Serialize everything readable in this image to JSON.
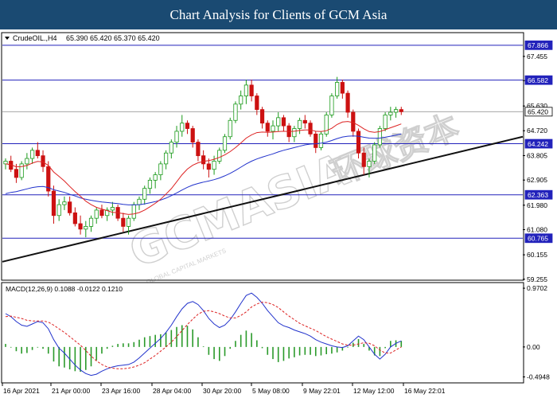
{
  "header": {
    "title": "Chart Analysis for Clients of GCM Asia"
  },
  "watermark": {
    "brand": "GCMASIA",
    "chinese": "环球资本",
    "sub": "GLOBAL CAPITAL MARKETS"
  },
  "colors": {
    "header_bg": "#1a4a72",
    "bull": "#1a9a1a",
    "bear": "#cc1111",
    "ma_fast": "#dd2222",
    "ma_slow": "#2233cc",
    "level_line": "#2222bb",
    "trend_line": "#111111",
    "macd_line": "#2233cc",
    "signal_line": "#dd2222",
    "hist": "#2a9a2a"
  },
  "chart_data": [
    {
      "type": "candlestick",
      "symbol_label": "CrudeOIL.,H4",
      "ohlc_label": "65.390 65.420 65.370 65.420",
      "ylim": [
        59.25,
        68.3
      ],
      "y_ticks": [
        "67.455",
        "66.565",
        "65.630",
        "64.720",
        "63.805",
        "62.905",
        "61.980",
        "61.080",
        "60.155",
        "59.255"
      ],
      "x_ticks": [
        "16 Apr 2021",
        "21 Apr 00:00",
        "23 Apr 16:00",
        "28 Apr 04:00",
        "30 Apr 20:00",
        "5 May 08:00",
        "9 May 22:01",
        "12 May 12:00",
        "16 May 22:01"
      ],
      "levels": [
        67.866,
        66.582,
        65.42,
        64.242,
        62.363,
        60.765
      ],
      "current_price": 65.42,
      "candles": [
        [
          63.5,
          63.7,
          63.3,
          63.6
        ],
        [
          63.6,
          63.8,
          63.2,
          63.3
        ],
        [
          63.3,
          63.5,
          62.8,
          63.0
        ],
        [
          63.0,
          63.6,
          62.9,
          63.5
        ],
        [
          63.5,
          63.9,
          63.3,
          63.7
        ],
        [
          63.7,
          64.1,
          63.5,
          64.0
        ],
        [
          64.0,
          64.3,
          63.7,
          63.8
        ],
        [
          63.8,
          64.0,
          63.2,
          63.4
        ],
        [
          63.4,
          63.6,
          62.3,
          62.5
        ],
        [
          62.5,
          62.7,
          61.3,
          61.6
        ],
        [
          61.6,
          62.2,
          61.4,
          62.0
        ],
        [
          62.0,
          62.3,
          61.8,
          62.1
        ],
        [
          62.1,
          62.3,
          61.6,
          61.7
        ],
        [
          61.7,
          61.9,
          61.2,
          61.3
        ],
        [
          61.3,
          61.6,
          60.9,
          61.1
        ],
        [
          61.1,
          61.4,
          60.8,
          61.2
        ],
        [
          61.2,
          61.6,
          61.0,
          61.5
        ],
        [
          61.5,
          61.9,
          61.3,
          61.8
        ],
        [
          61.8,
          62.0,
          61.5,
          61.6
        ],
        [
          61.6,
          61.9,
          61.4,
          61.8
        ],
        [
          61.8,
          62.1,
          61.6,
          61.9
        ],
        [
          61.9,
          62.0,
          61.4,
          61.5
        ],
        [
          61.5,
          61.7,
          61.0,
          61.2
        ],
        [
          61.2,
          61.6,
          60.9,
          61.5
        ],
        [
          61.5,
          62.1,
          61.4,
          62.0
        ],
        [
          62.0,
          62.3,
          61.8,
          62.2
        ],
        [
          62.2,
          62.7,
          62.0,
          62.6
        ],
        [
          62.6,
          63.0,
          62.4,
          62.9
        ],
        [
          62.9,
          63.2,
          62.6,
          63.1
        ],
        [
          63.1,
          63.6,
          62.9,
          63.5
        ],
        [
          63.5,
          64.0,
          63.3,
          63.9
        ],
        [
          63.9,
          64.4,
          63.7,
          64.3
        ],
        [
          64.3,
          64.9,
          64.1,
          64.7
        ],
        [
          64.7,
          65.3,
          64.5,
          65.0
        ],
        [
          65.0,
          65.1,
          64.6,
          64.8
        ],
        [
          64.8,
          64.9,
          64.1,
          64.3
        ],
        [
          64.3,
          64.4,
          63.6,
          63.8
        ],
        [
          63.8,
          64.0,
          63.3,
          63.5
        ],
        [
          63.5,
          63.7,
          63.0,
          63.3
        ],
        [
          63.3,
          63.8,
          63.1,
          63.6
        ],
        [
          63.6,
          64.1,
          63.5,
          64.0
        ],
        [
          64.0,
          64.6,
          63.9,
          64.5
        ],
        [
          64.5,
          65.2,
          64.4,
          65.1
        ],
        [
          65.1,
          65.8,
          65.0,
          65.7
        ],
        [
          65.7,
          66.2,
          65.5,
          66.0
        ],
        [
          66.0,
          66.6,
          65.7,
          66.4
        ],
        [
          66.4,
          66.6,
          65.8,
          66.0
        ],
        [
          66.0,
          66.1,
          65.3,
          65.5
        ],
        [
          65.5,
          65.6,
          64.8,
          65.0
        ],
        [
          65.0,
          65.1,
          64.5,
          64.7
        ],
        [
          64.7,
          65.1,
          64.4,
          64.9
        ],
        [
          64.9,
          65.4,
          64.7,
          65.2
        ],
        [
          65.2,
          65.3,
          64.7,
          64.9
        ],
        [
          64.9,
          65.0,
          64.3,
          64.5
        ],
        [
          64.5,
          64.9,
          64.3,
          64.8
        ],
        [
          64.8,
          65.2,
          64.6,
          65.1
        ],
        [
          65.1,
          65.3,
          64.8,
          65.0
        ],
        [
          65.0,
          65.1,
          64.5,
          64.6
        ],
        [
          64.6,
          64.7,
          63.9,
          64.1
        ],
        [
          64.1,
          64.7,
          64.0,
          64.6
        ],
        [
          64.6,
          65.4,
          64.5,
          65.3
        ],
        [
          65.3,
          66.1,
          65.2,
          66.0
        ],
        [
          66.0,
          66.7,
          65.9,
          66.5
        ],
        [
          66.5,
          66.6,
          65.9,
          66.1
        ],
        [
          66.1,
          66.2,
          65.2,
          65.4
        ],
        [
          65.4,
          65.5,
          64.5,
          64.7
        ],
        [
          64.7,
          64.8,
          63.7,
          63.9
        ],
        [
          63.9,
          64.1,
          63.1,
          63.4
        ],
        [
          63.4,
          63.7,
          63.0,
          63.6
        ],
        [
          63.6,
          64.3,
          63.5,
          64.2
        ],
        [
          64.2,
          64.9,
          64.1,
          64.8
        ],
        [
          64.8,
          65.4,
          64.7,
          65.3
        ],
        [
          65.3,
          65.6,
          65.1,
          65.4
        ],
        [
          65.4,
          65.6,
          65.2,
          65.5
        ],
        [
          65.5,
          65.6,
          65.3,
          65.42
        ]
      ],
      "ma_fast": [
        63.5,
        63.47,
        63.39,
        63.4,
        63.44,
        63.53,
        63.59,
        63.57,
        63.44,
        63.2,
        63.04,
        62.87,
        62.67,
        62.48,
        62.31,
        62.13,
        62.0,
        61.9,
        61.84,
        61.78,
        61.72,
        61.7,
        61.67,
        61.64,
        61.66,
        61.71,
        61.8,
        61.92,
        62.05,
        62.2,
        62.39,
        62.59,
        62.84,
        63.1,
        63.31,
        63.45,
        63.54,
        63.59,
        63.62,
        63.67,
        63.74,
        63.83,
        63.95,
        64.1,
        64.27,
        64.45,
        64.57,
        64.65,
        64.67,
        64.66,
        64.67,
        64.69,
        64.7,
        64.69,
        64.7,
        64.73,
        64.75,
        64.75,
        64.7,
        64.69,
        64.72,
        64.81,
        64.95,
        65.04,
        65.06,
        65.02,
        64.92,
        64.79,
        64.69,
        64.66,
        64.69,
        64.76,
        64.83,
        64.9,
        64.97
      ],
      "ma_slow": [
        62.4,
        62.45,
        62.48,
        62.53,
        62.58,
        62.63,
        62.66,
        62.67,
        62.63,
        62.55,
        62.5,
        62.45,
        62.38,
        62.32,
        62.25,
        62.2,
        62.16,
        62.13,
        62.1,
        62.08,
        62.06,
        62.04,
        62.01,
        61.99,
        61.99,
        62.0,
        62.03,
        62.07,
        62.11,
        62.17,
        62.24,
        62.33,
        62.43,
        62.54,
        62.64,
        62.72,
        62.78,
        62.83,
        62.87,
        62.92,
        62.98,
        63.06,
        63.15,
        63.26,
        63.38,
        63.5,
        63.6,
        63.68,
        63.75,
        63.81,
        63.87,
        63.94,
        64.0,
        64.05,
        64.1,
        64.15,
        64.2,
        64.23,
        64.24,
        64.26,
        64.3,
        64.36,
        64.43,
        64.49,
        64.52,
        64.53,
        64.52,
        64.48,
        64.45,
        64.44,
        64.45,
        64.48,
        64.52,
        64.56,
        64.6
      ],
      "trendline": {
        "from": [
          0,
          59.9
        ],
        "to": [
          74.5,
          64.5
        ]
      }
    },
    {
      "type": "macd",
      "label": "MACD(12,26,9) 0.1088 -0.0122 0.1210",
      "ylim": [
        -0.58,
        1.05
      ],
      "y_ticks": [
        "0.9702",
        "0.00",
        "-0.4948"
      ],
      "macd": [
        0.55,
        0.5,
        0.42,
        0.36,
        0.34,
        0.38,
        0.42,
        0.4,
        0.3,
        0.12,
        -0.02,
        -0.1,
        -0.2,
        -0.3,
        -0.38,
        -0.44,
        -0.47,
        -0.45,
        -0.4,
        -0.36,
        -0.33,
        -0.31,
        -0.3,
        -0.29,
        -0.25,
        -0.18,
        -0.1,
        -0.02,
        0.06,
        0.14,
        0.24,
        0.36,
        0.5,
        0.63,
        0.72,
        0.75,
        0.7,
        0.6,
        0.47,
        0.38,
        0.32,
        0.36,
        0.45,
        0.58,
        0.72,
        0.85,
        0.89,
        0.82,
        0.72,
        0.6,
        0.5,
        0.4,
        0.35,
        0.32,
        0.28,
        0.25,
        0.22,
        0.18,
        0.12,
        0.08,
        0.05,
        0.02,
        0.0,
        -0.01,
        0.02,
        0.1,
        0.18,
        0.12,
        0.0,
        -0.12,
        -0.2,
        -0.12,
        0.0,
        0.06,
        0.1
      ],
      "signal": [
        0.5,
        0.51,
        0.49,
        0.47,
        0.44,
        0.43,
        0.43,
        0.43,
        0.41,
        0.36,
        0.3,
        0.24,
        0.17,
        0.1,
        0.03,
        -0.06,
        -0.15,
        -0.23,
        -0.29,
        -0.33,
        -0.35,
        -0.36,
        -0.36,
        -0.35,
        -0.33,
        -0.3,
        -0.26,
        -0.2,
        -0.14,
        -0.07,
        0.0,
        0.08,
        0.17,
        0.27,
        0.37,
        0.46,
        0.54,
        0.59,
        0.6,
        0.58,
        0.55,
        0.51,
        0.48,
        0.48,
        0.52,
        0.58,
        0.66,
        0.71,
        0.74,
        0.73,
        0.7,
        0.65,
        0.58,
        0.51,
        0.45,
        0.39,
        0.35,
        0.31,
        0.27,
        0.22,
        0.17,
        0.13,
        0.09,
        0.05,
        0.03,
        0.03,
        0.05,
        0.07,
        0.06,
        0.02,
        -0.05,
        -0.1,
        -0.1,
        -0.05,
        0.0
      ],
      "histogram": [
        0.05,
        -0.01,
        -0.07,
        -0.11,
        -0.1,
        -0.05,
        -0.01,
        -0.03,
        -0.11,
        -0.24,
        -0.32,
        -0.34,
        -0.37,
        -0.4,
        -0.41,
        -0.38,
        -0.32,
        -0.22,
        -0.11,
        -0.03,
        0.02,
        0.05,
        0.06,
        0.06,
        0.08,
        0.12,
        0.16,
        0.18,
        0.2,
        0.21,
        0.24,
        0.28,
        0.33,
        0.36,
        0.35,
        0.29,
        0.16,
        0.01,
        -0.13,
        -0.2,
        -0.23,
        -0.15,
        -0.03,
        0.1,
        0.2,
        0.27,
        0.23,
        0.11,
        -0.02,
        -0.13,
        -0.2,
        -0.25,
        -0.23,
        -0.19,
        -0.17,
        -0.14,
        -0.13,
        -0.13,
        -0.15,
        -0.14,
        -0.12,
        -0.11,
        -0.09,
        -0.06,
        -0.01,
        0.07,
        0.13,
        0.05,
        -0.06,
        -0.14,
        -0.15,
        -0.02,
        0.1,
        0.11,
        0.1
      ]
    }
  ]
}
